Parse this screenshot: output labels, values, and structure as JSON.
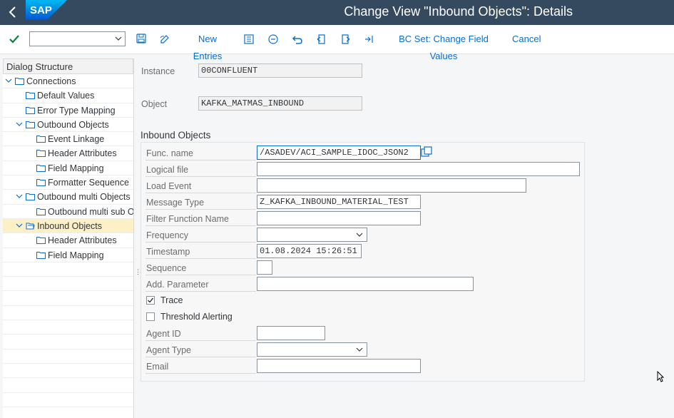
{
  "shell": {
    "title": "Change View \"Inbound Objects\": Details",
    "logo_text": "SAP"
  },
  "toolbar": {
    "new_entries_label": "New Entries",
    "bc_set_label": "BC Set: Change Field Values",
    "cancel_label": "Cancel",
    "okcode_value": ""
  },
  "tree": {
    "header": "Dialog Structure",
    "items": [
      {
        "label": "Connections"
      },
      {
        "label": "Default Values"
      },
      {
        "label": "Error Type Mapping"
      },
      {
        "label": "Outbound  Objects"
      },
      {
        "label": "Event Linkage"
      },
      {
        "label": "Header Attributes"
      },
      {
        "label": "Field Mapping"
      },
      {
        "label": "Formatter Sequence"
      },
      {
        "label": "Outbound multi Objects"
      },
      {
        "label": "Outbound multi sub Ob"
      },
      {
        "label": "Inbound Objects"
      },
      {
        "label": "Header Attributes"
      },
      {
        "label": "Field Mapping"
      }
    ]
  },
  "header_fields": {
    "instance_label": "Instance",
    "instance_value": "00CONFLUENT",
    "object_label": "Object",
    "object_value": "KAFKA_MATMAS_INBOUND"
  },
  "inbound": {
    "group_title": "Inbound Objects",
    "func_name_label": "Func. name",
    "func_name_value": "/ASADEV/ACI_SAMPLE_IDOC_JSON2",
    "logical_file_label": "Logical file",
    "logical_file_value": "",
    "load_event_label": "Load Event",
    "load_event_value": "",
    "message_type_label": "Message Type",
    "message_type_value": "Z_KAFKA_INBOUND_MATERIAL_TEST",
    "filter_function_label": "Filter Function Name",
    "filter_function_value": "",
    "frequency_label": "Frequency",
    "frequency_value": "",
    "timestamp_label": "Timestamp",
    "timestamp_value": "01.08.2024 15:26:51",
    "sequence_label": "Sequence",
    "sequence_value": "",
    "add_parameter_label": "Add. Parameter",
    "add_parameter_value": "",
    "trace_label": "Trace",
    "trace_checked": true,
    "threshold_label": "Threshold Alerting",
    "threshold_checked": false,
    "agent_id_label": "Agent ID",
    "agent_id_value": "",
    "agent_type_label": "Agent Type",
    "agent_type_value": "",
    "email_label": "Email",
    "email_value": ""
  },
  "colors": {
    "shell_bg": "#354a5f",
    "accent": "#0a6ed1",
    "selected_row": "#fcf0c6",
    "check_green": "#107e3e"
  }
}
